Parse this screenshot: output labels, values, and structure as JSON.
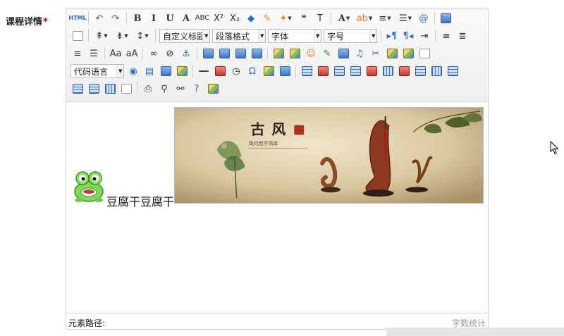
{
  "form": {
    "label": "课程详情",
    "required_mark": "*"
  },
  "toolbar": {
    "rows": [
      [
        {
          "name": "html-source-icon",
          "glyph": "HTML",
          "style": "tiny"
        },
        {
          "type": "sep"
        },
        {
          "name": "undo-icon",
          "glyph": "↶",
          "style": "blue"
        },
        {
          "name": "redo-icon",
          "glyph": "↷",
          "style": "blue"
        },
        {
          "type": "sep"
        },
        {
          "name": "bold-icon",
          "glyph": "B",
          "style": "serif"
        },
        {
          "name": "italic-icon",
          "glyph": "I",
          "style": "serif"
        },
        {
          "name": "underline-icon",
          "glyph": "U",
          "style": "serif"
        },
        {
          "name": "font-border-icon",
          "glyph": "A",
          "style": "serif"
        },
        {
          "name": "strikethrough-icon",
          "glyph": "ABC",
          "style": "small"
        },
        {
          "name": "superscript-icon",
          "glyph": "X²"
        },
        {
          "name": "subscript-icon",
          "glyph": "X₂"
        },
        {
          "name": "remove-format-icon",
          "glyph": "◆",
          "style": "blue"
        },
        {
          "name": "format-match-icon",
          "glyph": "✎",
          "style": "orange"
        },
        {
          "name": "auto-typeset-icon",
          "glyph": "✦",
          "style": "orange",
          "caret": true
        },
        {
          "name": "blockquote-icon",
          "glyph": "❝"
        },
        {
          "name": "paste-plain-icon",
          "glyph": "T"
        },
        {
          "type": "sep"
        },
        {
          "name": "font-color-icon",
          "glyph": "A",
          "style": "serif",
          "caret": true
        },
        {
          "name": "background-color-icon",
          "glyph": "ab",
          "style": "orange",
          "caret": true
        },
        {
          "name": "ordered-list-icon",
          "glyph": "≡",
          "caret": true
        },
        {
          "name": "unordered-list-icon",
          "glyph": "☰",
          "caret": true
        },
        {
          "name": "select-all-icon",
          "glyph": "@",
          "style": "blue"
        },
        {
          "type": "sep"
        },
        {
          "name": "preview-icon",
          "icon": "blue"
        }
      ],
      [
        {
          "name": "new-page-icon",
          "icon": "page"
        },
        {
          "type": "sep"
        },
        {
          "name": "row-spacing-top-icon",
          "glyph": "⇞",
          "caret": true
        },
        {
          "name": "row-spacing-bottom-icon",
          "glyph": "⇟",
          "caret": true
        },
        {
          "name": "line-height-icon",
          "glyph": "↕",
          "caret": true
        },
        {
          "type": "sep"
        },
        {
          "name": "custom-title-select",
          "select": "custom_title",
          "width": 72
        },
        {
          "name": "paragraph-format-select",
          "select": "paragraph",
          "width": 76
        },
        {
          "name": "font-family-select",
          "select": "font_family",
          "width": 76
        },
        {
          "name": "font-size-select",
          "select": "font_size",
          "width": 76
        },
        {
          "type": "sep"
        },
        {
          "name": "ltr-direction-icon",
          "glyph": "▸¶",
          "style": "blue"
        },
        {
          "name": "rtl-direction-icon",
          "glyph": "¶◂",
          "style": "blue"
        },
        {
          "name": "indent-icon",
          "glyph": "⇥"
        },
        {
          "type": "sep"
        },
        {
          "name": "align-left-icon",
          "glyph": "≡"
        },
        {
          "name": "align-center-icon",
          "glyph": "≣"
        }
      ],
      [
        {
          "name": "align-right-icon",
          "glyph": "≡"
        },
        {
          "name": "align-justify-icon",
          "glyph": "☰"
        },
        {
          "type": "sep"
        },
        {
          "name": "to-uppercase-icon",
          "glyph": "Aa"
        },
        {
          "name": "to-lowercase-icon",
          "glyph": "aA"
        },
        {
          "type": "sep"
        },
        {
          "name": "link-icon",
          "glyph": "∞"
        },
        {
          "name": "unlink-icon",
          "glyph": "⊘"
        },
        {
          "name": "anchor-icon",
          "glyph": "⚓",
          "style": "blue"
        },
        {
          "type": "sep"
        },
        {
          "name": "image-none-icon",
          "icon": "blue"
        },
        {
          "name": "image-left-icon",
          "icon": "blue"
        },
        {
          "name": "image-right-icon",
          "icon": "blue"
        },
        {
          "name": "image-center-icon",
          "icon": "blue"
        },
        {
          "type": "sep"
        },
        {
          "name": "simple-upload-icon",
          "icon": "img"
        },
        {
          "name": "insert-image-icon",
          "icon": "img"
        },
        {
          "name": "emotion-icon",
          "glyph": "☺",
          "style": "orange"
        },
        {
          "name": "scrawl-icon",
          "glyph": "✎",
          "style": "green"
        },
        {
          "name": "insert-video-icon",
          "icon": "blue"
        },
        {
          "name": "music-icon",
          "glyph": "♫",
          "style": "blue"
        },
        {
          "name": "attachment-icon",
          "glyph": "✂",
          "style": "blue"
        },
        {
          "name": "map-icon",
          "icon": "img"
        },
        {
          "name": "gmap-icon",
          "icon": "img"
        },
        {
          "name": "insert-frame-icon",
          "icon": "page"
        }
      ],
      [
        {
          "name": "code-language-select",
          "select": "code_language",
          "width": 76
        },
        {
          "name": "page-break-icon",
          "glyph": "◉",
          "style": "blue"
        },
        {
          "name": "template-icon",
          "glyph": "▤",
          "style": "blue"
        },
        {
          "name": "background-icon",
          "icon": "blue"
        },
        {
          "name": "word-image-icon",
          "icon": "img"
        },
        {
          "type": "sep"
        },
        {
          "name": "horizontal-rule-icon",
          "icon": "line"
        },
        {
          "name": "date-icon",
          "icon": "red"
        },
        {
          "name": "time-icon",
          "glyph": "◷"
        },
        {
          "name": "special-chars-icon",
          "glyph": "Ω",
          "style": "blue"
        },
        {
          "name": "search-replace-icon",
          "icon": "img"
        },
        {
          "name": "word-import-icon",
          "icon": "blue"
        },
        {
          "type": "sep"
        },
        {
          "name": "insert-table-icon",
          "icon": "grid"
        },
        {
          "name": "delete-table-icon",
          "icon": "red"
        },
        {
          "name": "insert-paragraph-before-table-icon",
          "icon": "grid"
        },
        {
          "name": "insert-row-icon",
          "icon": "grid"
        },
        {
          "name": "delete-row-icon",
          "icon": "red"
        },
        {
          "name": "insert-col-icon",
          "icon": "grid2"
        },
        {
          "name": "delete-col-icon",
          "icon": "red"
        },
        {
          "name": "merge-cells-icon",
          "icon": "grid"
        },
        {
          "name": "merge-right-icon",
          "icon": "grid2"
        },
        {
          "name": "merge-down-icon",
          "icon": "grid"
        }
      ],
      [
        {
          "name": "split-to-cells-icon",
          "icon": "grid"
        },
        {
          "name": "split-to-rows-icon",
          "icon": "grid"
        },
        {
          "name": "split-to-cols-icon",
          "icon": "grid2"
        },
        {
          "name": "chart-icon",
          "icon": "page"
        },
        {
          "type": "sep"
        },
        {
          "name": "print-icon",
          "glyph": "⎙"
        },
        {
          "name": "preview-search-icon",
          "glyph": "⚲"
        },
        {
          "name": "find-icon",
          "glyph": "⚯"
        },
        {
          "name": "help-icon",
          "glyph": "?",
          "style": "blue"
        },
        {
          "name": "drafts-icon",
          "icon": "img"
        }
      ]
    ],
    "selects": {
      "custom_title": "自定义标题",
      "paragraph": "段落格式",
      "font_family": "字体",
      "font_size": "字号",
      "code_language": "代码语言"
    }
  },
  "content": {
    "inline_text": "豆腐干豆腐干",
    "emoticon": "frog-emoticon",
    "banner": {
      "title_chars": [
        "古",
        "风"
      ],
      "subtitle": "简约而不简单"
    }
  },
  "statusbar": {
    "path_label": "元素路径:",
    "word_count": "字数统计"
  },
  "colors": {
    "toolbar_bg": "#eeeeee",
    "border": "#d4d4d4",
    "required": "#dd0000",
    "icon_blue": "#2b6cc4"
  }
}
